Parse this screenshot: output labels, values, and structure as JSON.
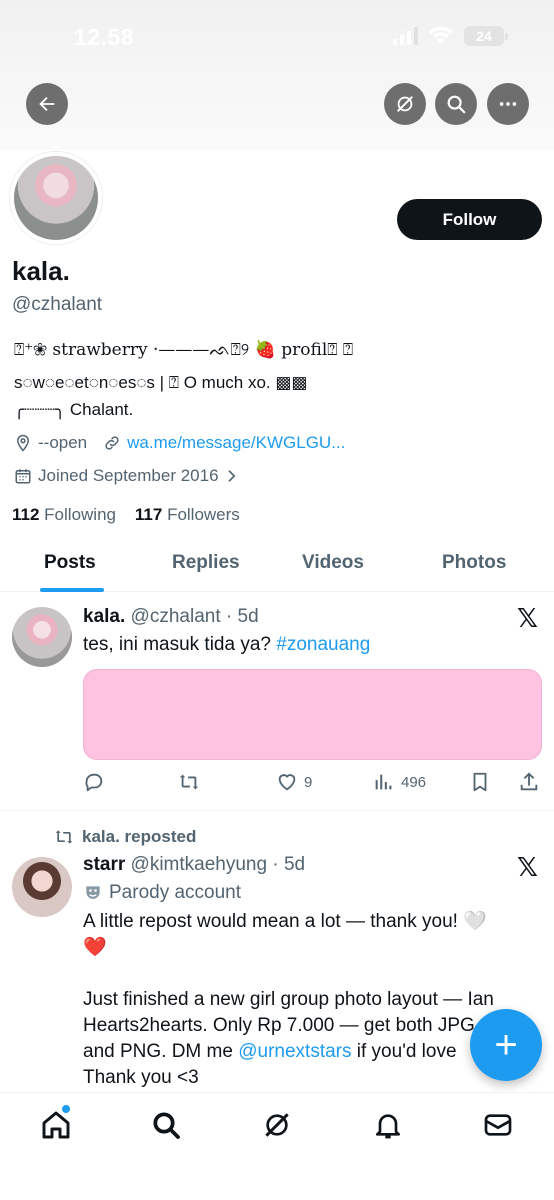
{
  "status_bar": {
    "time": "12.58",
    "battery": "24"
  },
  "header": {
    "back_icon": "arrow-left-icon",
    "grok_icon": "grok-icon",
    "search_icon": "search-icon",
    "more_icon": "more-icon"
  },
  "profile": {
    "name": "kala.",
    "handle": "@czhalant",
    "follow_label": "Follow",
    "bio_line1": "⍰⁺❀ strawberry ·———ᨒ⍰୨ 🍓 profil⍰ ⍰",
    "bio_line2": "s◌w◌e◌et◌n◌es◌s | ⍰ O much xo. ▩▩",
    "bio_line3": "╭┈┈┈╮ Chalant.",
    "location": "--open",
    "website": "wa.me/message/KWGLGU...",
    "joined": "Joined September 2016",
    "following_count": "112",
    "following_label": "Following",
    "followers_count": "117",
    "followers_label": "Followers"
  },
  "tabs": [
    {
      "label": "Posts",
      "active": true
    },
    {
      "label": "Replies",
      "active": false
    },
    {
      "label": "Videos",
      "active": false
    },
    {
      "label": "Photos",
      "active": false
    }
  ],
  "posts": [
    {
      "name": "kala.",
      "handle": "@czhalant",
      "age": "5d",
      "text": "tes, ini masuk tida ya?",
      "hashtag": "#zonauang",
      "media_color": "#fdc3e0",
      "likes": "9",
      "views": "496"
    },
    {
      "repost_label": "kala. reposted",
      "name": "starr",
      "handle": "@kimtkaehyung",
      "age": "5d",
      "parody_label": "Parody account",
      "line1": "A little repost would mean a lot — thank you! 🤍",
      "line2": "❤️",
      "line3": "Just finished a new girl group photo layout — Ian",
      "line4": "Hearts2hearts. Only Rp 7.000 — get both JPG",
      "line5_start": "and PNG. DM me",
      "mention": "@urnextstars",
      "line5_end": "if you'd love",
      "line6": "Thank you <3"
    }
  ],
  "fab": {
    "label": "+"
  },
  "bottom_nav": [
    "home-icon",
    "search-icon",
    "grok-icon",
    "notifications-icon",
    "messages-icon"
  ],
  "colors": {
    "accent": "#1d9bf0",
    "text": "#0f1419",
    "muted": "#536471",
    "media_pink": "#fdc3e0"
  }
}
